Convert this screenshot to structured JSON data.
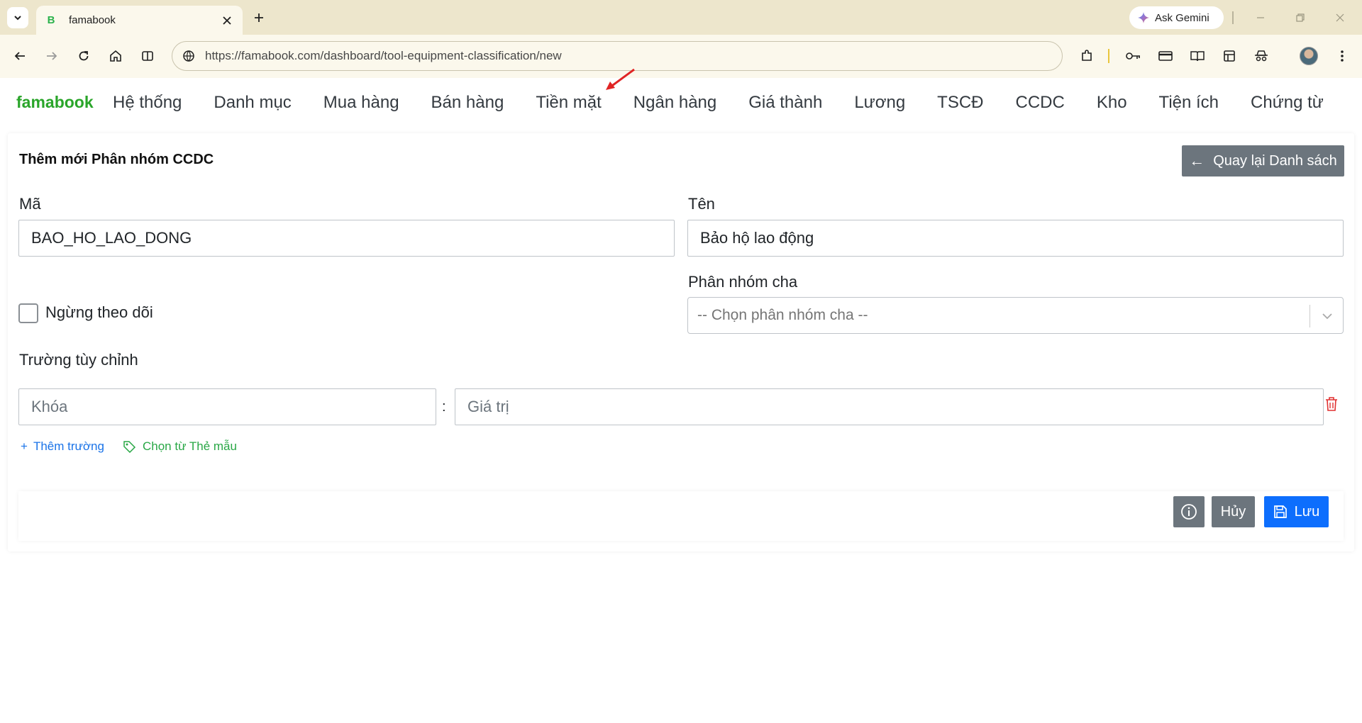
{
  "browser": {
    "tab_title": "famabook",
    "favicon_letter": "B",
    "gemini_label": "Ask Gemini",
    "url": "https://famabook.com/dashboard/tool-equipment-classification/new"
  },
  "app": {
    "brand": "famabook",
    "nav": [
      "Hệ thống",
      "Danh mục",
      "Mua hàng",
      "Bán hàng",
      "Tiền mặt",
      "Ngân hàng",
      "Giá thành",
      "Lương",
      "TSCĐ",
      "CCDC",
      "Kho",
      "Tiện ích",
      "Chứng từ"
    ]
  },
  "form": {
    "title": "Thêm mới Phân nhóm CCDC",
    "back_label": "Quay lại Danh sách",
    "code_label": "Mã",
    "code_value": "BAO_HO_LAO_DONG",
    "name_label": "Tên",
    "name_value": "Bảo hộ lao động",
    "parent_label": "Phân nhóm cha",
    "parent_placeholder": "-- Chọn phân nhóm cha --",
    "inactive_label": "Ngừng theo dõi",
    "custom_fields_label": "Trường tùy chỉnh",
    "key_placeholder": "Khóa",
    "value_placeholder": "Giá trị",
    "separator": ":",
    "add_field_label": "Thêm trường",
    "template_label": "Chọn từ Thẻ mẫu",
    "cancel_label": "Hủy",
    "save_label": "Lưu"
  },
  "colors": {
    "brand": "#2aa52a",
    "primary": "#0d6efd",
    "secondary": "#6c757d",
    "danger": "#e03131",
    "tabstrip": "#ede6cc"
  }
}
